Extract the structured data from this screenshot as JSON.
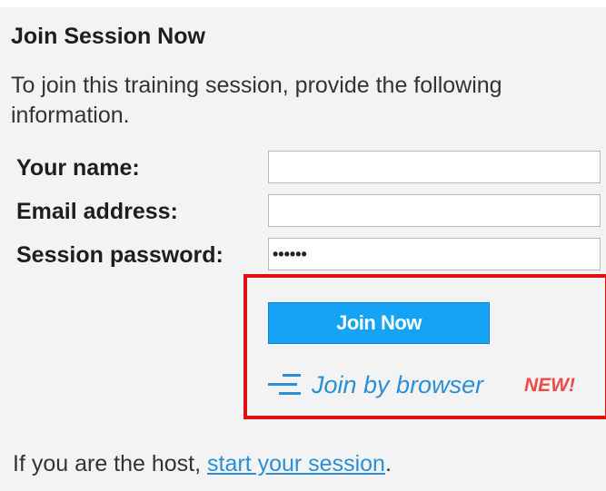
{
  "heading": "Join Session Now",
  "intro": "To join this training session, provide the following information.",
  "form": {
    "name_label": "Your name:",
    "name_value": "",
    "email_label": "Email address:",
    "email_value": "",
    "password_label": "Session password:",
    "password_value": "••••••"
  },
  "actions": {
    "join_now_label": "Join Now",
    "join_browser_label": "Join by browser",
    "new_badge": "NEW!",
    "browser_icon": "list-lines-icon"
  },
  "host": {
    "prefix": "If you are the host, ",
    "link_label": "start your session",
    "suffix": "."
  },
  "colors": {
    "accent_button": "#14a3f5",
    "link": "#2a8fd6",
    "highlight": "#e01010",
    "new_badge": "#ef4a4a"
  }
}
